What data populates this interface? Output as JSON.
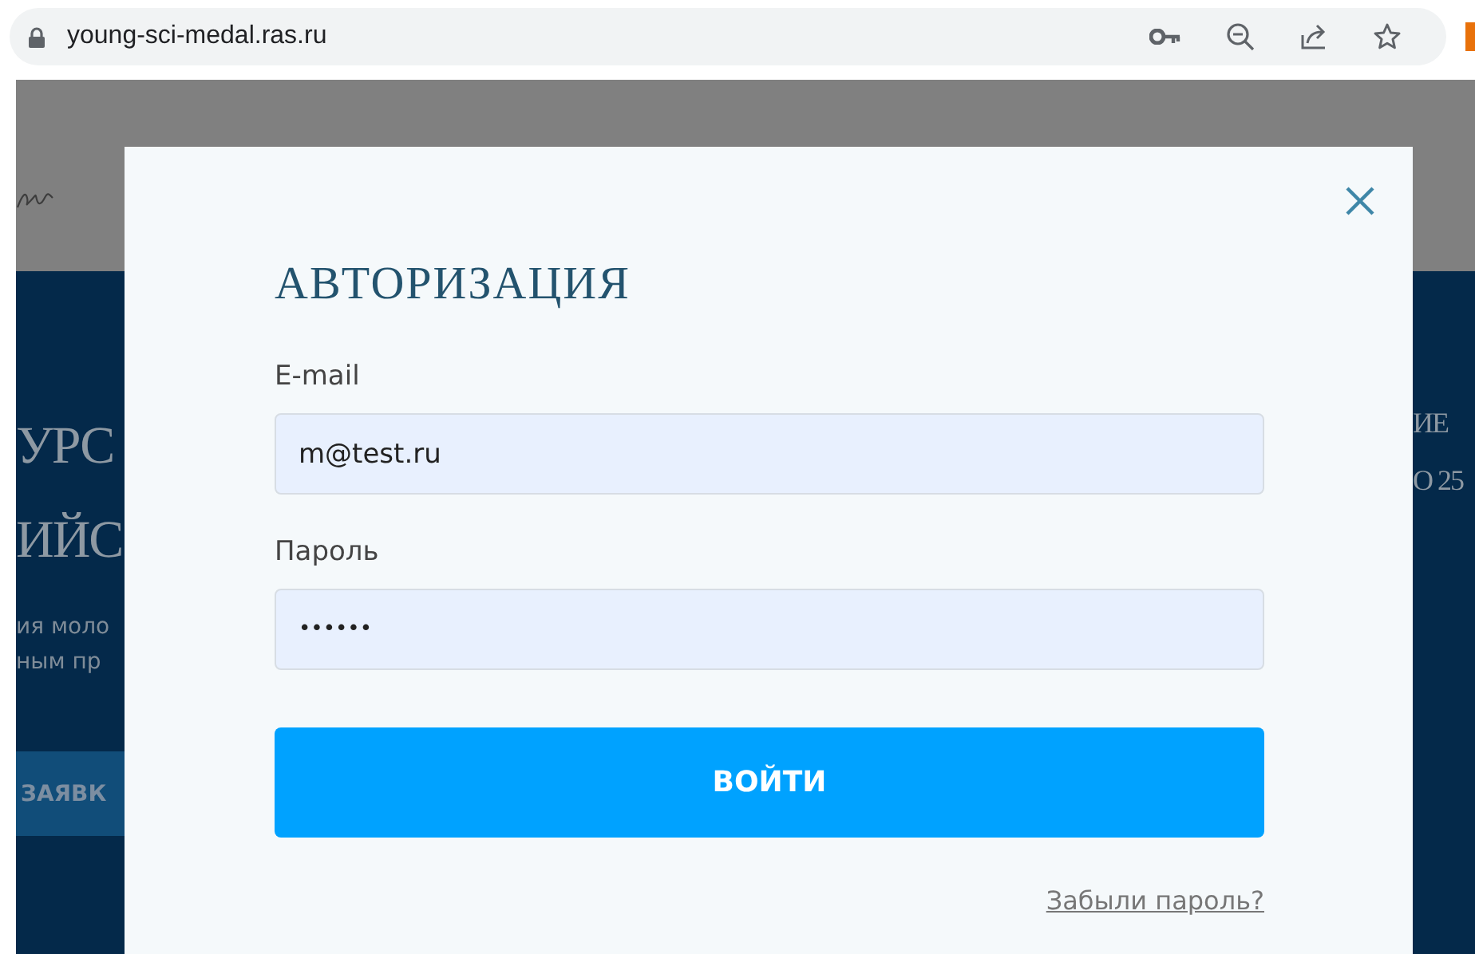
{
  "browser": {
    "url": "young-sci-medal.ras.ru"
  },
  "background": {
    "hero_left": [
      {
        "kind": "title",
        "text": "УРС"
      },
      {
        "kind": "title",
        "text": "ИЙС"
      },
      {
        "kind": "subtitle",
        "text": "ия моло"
      },
      {
        "kind": "subtitle",
        "text": "ным пр"
      }
    ],
    "apply_button": "ЗАЯВК",
    "hero_right": [
      {
        "kind": "title",
        "text": "ИЕ"
      },
      {
        "kind": "title",
        "text": "О 25"
      }
    ]
  },
  "modal": {
    "title": "АВТОРИЗАЦИЯ",
    "fields": [
      {
        "kind": "text",
        "label": "E-mail",
        "value": "m@test.ru"
      },
      {
        "kind": "password",
        "label": "Пароль",
        "value": "••••••"
      }
    ],
    "submit": "ВОЙТИ",
    "forgot_link": "Забыли пароль?"
  }
}
